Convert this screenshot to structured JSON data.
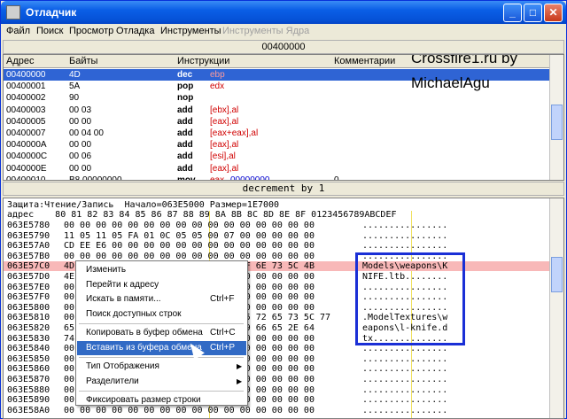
{
  "window": {
    "title": "Отладчик"
  },
  "menu": [
    "Файл",
    "Поиск",
    "Просмотр",
    "Отладка",
    "Инструменты",
    "Инструменты Ядра"
  ],
  "address_bar": "00400000",
  "disasm": {
    "columns": [
      "Адрес",
      "Байты",
      "Инструкции",
      "Комментарии"
    ],
    "rows": [
      {
        "addr": "00400000",
        "bytes": "4D",
        "ins": "dec",
        "ops": "ebp",
        "selected": true
      },
      {
        "addr": "00400001",
        "bytes": "5A",
        "ins": "pop",
        "ops": "edx"
      },
      {
        "addr": "00400002",
        "bytes": "90",
        "ins": "nop",
        "ops": ""
      },
      {
        "addr": "00400003",
        "bytes": "00 03",
        "ins": "add",
        "ops": "[ebx],al"
      },
      {
        "addr": "00400005",
        "bytes": "00 00",
        "ins": "add",
        "ops": "[eax],al"
      },
      {
        "addr": "00400007",
        "bytes": "00 04 00",
        "ins": "add",
        "ops": "[eax+eax],al"
      },
      {
        "addr": "0040000A",
        "bytes": "00 00",
        "ins": "add",
        "ops": "[eax],al"
      },
      {
        "addr": "0040000C",
        "bytes": "00 06",
        "ins": "add",
        "ops": "[esi],al"
      },
      {
        "addr": "0040000E",
        "bytes": "00 00",
        "ins": "add",
        "ops": "[eax],al"
      },
      {
        "addr": "00400010",
        "bytes": "B8 00000000",
        "ins": "mov",
        "ops": "eax,",
        "ops2": "00000000",
        "comment": "0"
      }
    ],
    "watermark_line1": "Crossfire1.ru by",
    "watermark_line2": "MichaelAgu"
  },
  "status_line": "decrement by 1",
  "hex": {
    "info_line": "Защита:Чтение/Запись  Начало=063E5000 Размер=1E7000",
    "header_line": "адрес    80 81 82 83 84 85 86 87 88 89 8A 8B 8C 8D 8E 8F 0123456789ABCDEF",
    "rows": [
      {
        "a": "063E5780",
        "b": "00 00 00 00 00 00 00 00 00 00 00 00 00 00 00 00",
        "c": "................"
      },
      {
        "a": "063E5790",
        "b": "11 05 11 05 FA 01 0C 05 05 00 07 00 00 00 00 00",
        "c": "................"
      },
      {
        "a": "063E57A0",
        "b": "CD EE E6 00 00 00 00 00 00 00 00 00 00 00 00 00",
        "c": "................"
      },
      {
        "a": "063E57B0",
        "b": "00 00 00 00 00 00 00 00 00 00 00 00 00 00 00 00",
        "c": "................"
      },
      {
        "a": "063E57C0",
        "b": "4D 6F 64 65 6C 73 5C 77 65 61 70 6F 6E 73 5C 4B",
        "c": "Models\\weapons\\K",
        "sel": true
      },
      {
        "a": "063E57D0",
        "b": "4E 49 46 45 2E 6C 74 62 00 00 00 00 00 00 00 00",
        "c": "NIFE.ltb........"
      },
      {
        "a": "063E57E0",
        "b": "00 00 00 00 00 00 00 00 00 00 00 00 00 00 00 00",
        "c": "................"
      },
      {
        "a": "063E57F0",
        "b": "00 00 00 00 00 00 00 00 00 00 00 00 00 00 00 00",
        "c": "................"
      },
      {
        "a": "063E5800",
        "b": "00 00 00 00 00 00 00 00 00 00 00 00 00 00 00 00",
        "c": "................"
      },
      {
        "a": "063E5810",
        "b": "00 2E 4D 6F 64 65 6C 54 65 78 74 75 72 65 73 5C 77",
        "c": ".ModelTextures\\w"
      },
      {
        "a": "063E5820",
        "b": "65 61 70 6F 6E 73 5C 6C 2D 6B 6E 69 66 65 2E 64",
        "c": "eapons\\l-knife.d"
      },
      {
        "a": "063E5830",
        "b": "74 78 00 00 00 00 00 00 00 00 00 00 00 00 00 00",
        "c": "tx.............."
      },
      {
        "a": "063E5840",
        "b": "00 00 00 00 00 00 00 00 00 00 00 00 00 00 00 00",
        "c": "................"
      },
      {
        "a": "063E5850",
        "b": "00 00 00 00 00 00 00 00 00 00 00 00 00 00 00 00",
        "c": "................"
      },
      {
        "a": "063E5860",
        "b": "00 00 00 00 00 00 00 00 00 00 00 00 00 00 00 00",
        "c": "................"
      },
      {
        "a": "063E5870",
        "b": "00 00 00 00 00 00 00 00 00 00 00 00 00 00 00 00",
        "c": "................"
      },
      {
        "a": "063E5880",
        "b": "00 00 00 00 00 00 00 00 00 00 00 00 00 00 00 00",
        "c": "................"
      },
      {
        "a": "063E5890",
        "b": "00 00 00 00 00 00 00 00 00 00 00 00 00 00 00 00",
        "c": "................"
      },
      {
        "a": "063E58A0",
        "b": "00 00 00 00 00 00 00 00 00 00 00 00 00 00 00 00",
        "c": "................"
      }
    ]
  },
  "context_menu": {
    "items": [
      {
        "label": "Изменить",
        "shortcut": ""
      },
      {
        "label": "Перейти к адресу",
        "shortcut": ""
      },
      {
        "label": "Искать в памяти...",
        "shortcut": "Ctrl+F"
      },
      {
        "label": "Поиск доступных строк",
        "shortcut": ""
      },
      {
        "label": "Копировать в буфер обмена",
        "shortcut": "Ctrl+C"
      },
      {
        "label": "Вставить из буфера обмена",
        "shortcut": "Ctrl+P",
        "highlighted": true
      },
      {
        "label": "Тип Отображения",
        "shortcut": "",
        "submenu": true
      },
      {
        "label": "Разделители",
        "shortcut": "",
        "submenu": true
      },
      {
        "label": "Фиксировать размер строки",
        "shortcut": ""
      }
    ]
  }
}
